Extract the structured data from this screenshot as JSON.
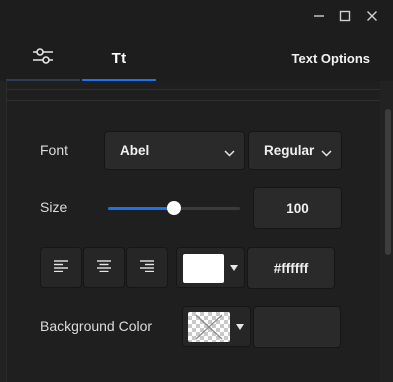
{
  "window": {
    "controls": {
      "minimize_icon": "minimize-icon",
      "maximize_icon": "maximize-icon",
      "close_icon": "close-icon"
    }
  },
  "tabs": [
    {
      "id": "adjustments",
      "icon": "sliders-icon",
      "label": ""
    },
    {
      "id": "text",
      "label": "Tt",
      "active": true
    }
  ],
  "panel_title": "Text Options",
  "font": {
    "label": "Font",
    "family": "Abel",
    "weight": "Regular"
  },
  "size": {
    "label": "Size",
    "value": "100",
    "slider_fraction": 0.5
  },
  "alignment": {
    "options": [
      "align-left",
      "align-center",
      "align-right"
    ]
  },
  "text_color": {
    "swatch": "#ffffff",
    "hex_value": "#ffffff"
  },
  "background_color": {
    "label": "Background Color",
    "swatch": "transparent",
    "hex_value": ""
  },
  "colors": {
    "accent": "#1a73e8",
    "background": "#1d1d1d",
    "panel": "#222222",
    "control": "#2a2a2a"
  }
}
